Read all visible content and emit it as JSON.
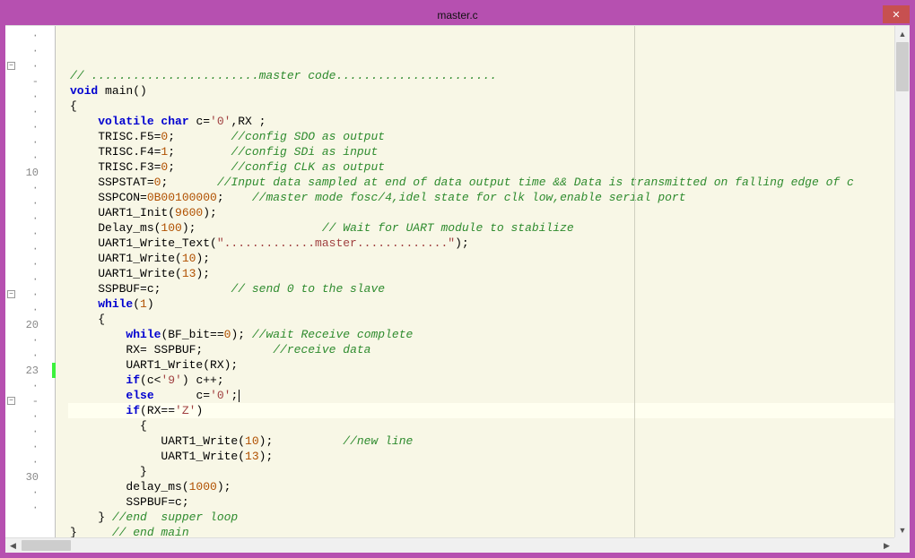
{
  "window": {
    "title": "master.c",
    "close_label": "✕"
  },
  "colors": {
    "frame": "#b650b0",
    "editor_bg": "#f8f7e6",
    "comment": "#2e8b2e",
    "keyword": "#0000d0",
    "number": "#b05000",
    "string": "#a04040"
  },
  "editor": {
    "current_line_index": 22,
    "gutter": [
      {
        "n": "·"
      },
      {
        "n": "·"
      },
      {
        "n": "·"
      },
      {
        "n": "-"
      },
      {
        "n": "·"
      },
      {
        "n": "·"
      },
      {
        "n": "·"
      },
      {
        "n": "·"
      },
      {
        "n": "·"
      },
      {
        "n": "10"
      },
      {
        "n": "·"
      },
      {
        "n": "·"
      },
      {
        "n": "·"
      },
      {
        "n": "·"
      },
      {
        "n": "·"
      },
      {
        "n": "·"
      },
      {
        "n": "·"
      },
      {
        "n": "·"
      },
      {
        "n": "·"
      },
      {
        "n": "20"
      },
      {
        "n": "·"
      },
      {
        "n": "·"
      },
      {
        "n": "23"
      },
      {
        "n": "·"
      },
      {
        "n": "-"
      },
      {
        "n": "·"
      },
      {
        "n": "·"
      },
      {
        "n": "·"
      },
      {
        "n": "·"
      },
      {
        "n": "30"
      },
      {
        "n": "·"
      },
      {
        "n": "·"
      }
    ],
    "fold": [
      {
        "row": 2,
        "sym": "−"
      },
      {
        "row": 17,
        "sym": "−"
      },
      {
        "row": 24,
        "sym": "−"
      }
    ],
    "lines": [
      {
        "frags": [
          {
            "t": "// ........................master code.......................",
            "cls": "cm"
          }
        ]
      },
      {
        "frags": [
          {
            "t": "void",
            "cls": "kw"
          },
          {
            "t": " main()",
            "cls": "plain"
          }
        ]
      },
      {
        "frags": [
          {
            "t": "{",
            "cls": "plain"
          }
        ]
      },
      {
        "frags": [
          {
            "t": "    ",
            "cls": "plain"
          },
          {
            "t": "volatile char",
            "cls": "kw"
          },
          {
            "t": " c=",
            "cls": "plain"
          },
          {
            "t": "'0'",
            "cls": "str"
          },
          {
            "t": ",RX ;",
            "cls": "plain"
          }
        ]
      },
      {
        "frags": [
          {
            "t": "    TRISC.F5=",
            "cls": "plain"
          },
          {
            "t": "0",
            "cls": "num"
          },
          {
            "t": ";        ",
            "cls": "plain"
          },
          {
            "t": "//config SDO as output",
            "cls": "cm"
          }
        ]
      },
      {
        "frags": [
          {
            "t": "    TRISC.F4=",
            "cls": "plain"
          },
          {
            "t": "1",
            "cls": "num"
          },
          {
            "t": ";        ",
            "cls": "plain"
          },
          {
            "t": "//config SDi as input",
            "cls": "cm"
          }
        ]
      },
      {
        "frags": [
          {
            "t": "    TRISC.F3=",
            "cls": "plain"
          },
          {
            "t": "0",
            "cls": "num"
          },
          {
            "t": ";        ",
            "cls": "plain"
          },
          {
            "t": "//config CLK as output",
            "cls": "cm"
          }
        ]
      },
      {
        "frags": [
          {
            "t": "    SSPSTAT=",
            "cls": "plain"
          },
          {
            "t": "0",
            "cls": "num"
          },
          {
            "t": ";       ",
            "cls": "plain"
          },
          {
            "t": "//Input data sampled at end of data output time && Data is transmitted on falling edge of c",
            "cls": "cm"
          }
        ]
      },
      {
        "frags": [
          {
            "t": "    SSPCON=",
            "cls": "plain"
          },
          {
            "t": "0B00100000",
            "cls": "num"
          },
          {
            "t": ";    ",
            "cls": "plain"
          },
          {
            "t": "//master mode fosc/4,idel state for clk low,enable serial port",
            "cls": "cm"
          }
        ]
      },
      {
        "frags": [
          {
            "t": "    UART1_Init(",
            "cls": "plain"
          },
          {
            "t": "9600",
            "cls": "num"
          },
          {
            "t": ");",
            "cls": "plain"
          }
        ]
      },
      {
        "frags": [
          {
            "t": "    Delay_ms(",
            "cls": "plain"
          },
          {
            "t": "100",
            "cls": "num"
          },
          {
            "t": ");                  ",
            "cls": "plain"
          },
          {
            "t": "// Wait for UART module to stabilize",
            "cls": "cm"
          }
        ]
      },
      {
        "frags": [
          {
            "t": "    UART1_Write_Text(",
            "cls": "plain"
          },
          {
            "t": "\".............master.............\"",
            "cls": "str"
          },
          {
            "t": ");",
            "cls": "plain"
          }
        ]
      },
      {
        "frags": [
          {
            "t": "    UART1_Write(",
            "cls": "plain"
          },
          {
            "t": "10",
            "cls": "num"
          },
          {
            "t": ");",
            "cls": "plain"
          }
        ]
      },
      {
        "frags": [
          {
            "t": "    UART1_Write(",
            "cls": "plain"
          },
          {
            "t": "13",
            "cls": "num"
          },
          {
            "t": ");",
            "cls": "plain"
          }
        ]
      },
      {
        "frags": [
          {
            "t": "    SSPBUF=c;          ",
            "cls": "plain"
          },
          {
            "t": "// send 0 to the slave",
            "cls": "cm"
          }
        ]
      },
      {
        "frags": [
          {
            "t": "    ",
            "cls": "plain"
          },
          {
            "t": "while",
            "cls": "kw"
          },
          {
            "t": "(",
            "cls": "plain"
          },
          {
            "t": "1",
            "cls": "num"
          },
          {
            "t": ")",
            "cls": "plain"
          }
        ]
      },
      {
        "frags": [
          {
            "t": "    {",
            "cls": "plain"
          }
        ]
      },
      {
        "frags": [
          {
            "t": "        ",
            "cls": "plain"
          },
          {
            "t": "while",
            "cls": "kw"
          },
          {
            "t": "(BF_bit==",
            "cls": "plain"
          },
          {
            "t": "0",
            "cls": "num"
          },
          {
            "t": "); ",
            "cls": "plain"
          },
          {
            "t": "//wait Receive complete",
            "cls": "cm"
          }
        ]
      },
      {
        "frags": [
          {
            "t": "        RX= SSPBUF;          ",
            "cls": "plain"
          },
          {
            "t": "//receive data",
            "cls": "cm"
          }
        ]
      },
      {
        "frags": [
          {
            "t": "        UART1_Write(RX);",
            "cls": "plain"
          }
        ]
      },
      {
        "frags": [
          {
            "t": "        ",
            "cls": "plain"
          },
          {
            "t": "if",
            "cls": "kw"
          },
          {
            "t": "(c<",
            "cls": "plain"
          },
          {
            "t": "'9'",
            "cls": "str"
          },
          {
            "t": ") c++;",
            "cls": "plain"
          }
        ]
      },
      {
        "frags": [
          {
            "t": "        ",
            "cls": "plain"
          },
          {
            "t": "else",
            "cls": "kw"
          },
          {
            "t": "      c=",
            "cls": "plain"
          },
          {
            "t": "'0'",
            "cls": "str"
          },
          {
            "t": ";",
            "cls": "plain"
          }
        ],
        "cursor": true
      },
      {
        "frags": [
          {
            "t": "        ",
            "cls": "plain"
          },
          {
            "t": "if",
            "cls": "kw"
          },
          {
            "t": "(RX==",
            "cls": "plain"
          },
          {
            "t": "'Z'",
            "cls": "str"
          },
          {
            "t": ")",
            "cls": "plain"
          }
        ]
      },
      {
        "frags": [
          {
            "t": "          {",
            "cls": "plain"
          }
        ]
      },
      {
        "frags": [
          {
            "t": "             UART1_Write(",
            "cls": "plain"
          },
          {
            "t": "10",
            "cls": "num"
          },
          {
            "t": ");          ",
            "cls": "plain"
          },
          {
            "t": "//new line",
            "cls": "cm"
          }
        ]
      },
      {
        "frags": [
          {
            "t": "             UART1_Write(",
            "cls": "plain"
          },
          {
            "t": "13",
            "cls": "num"
          },
          {
            "t": ");",
            "cls": "plain"
          }
        ]
      },
      {
        "frags": [
          {
            "t": "          }",
            "cls": "plain"
          }
        ]
      },
      {
        "frags": [
          {
            "t": "        delay_ms(",
            "cls": "plain"
          },
          {
            "t": "1000",
            "cls": "num"
          },
          {
            "t": ");",
            "cls": "plain"
          }
        ]
      },
      {
        "frags": [
          {
            "t": "        SSPBUF=c;",
            "cls": "plain"
          }
        ]
      },
      {
        "frags": [
          {
            "t": "    } ",
            "cls": "plain"
          },
          {
            "t": "//end  supper loop",
            "cls": "cm"
          }
        ]
      },
      {
        "frags": [
          {
            "t": "}     ",
            "cls": "plain"
          },
          {
            "t": "// end main",
            "cls": "cm"
          }
        ]
      }
    ]
  }
}
